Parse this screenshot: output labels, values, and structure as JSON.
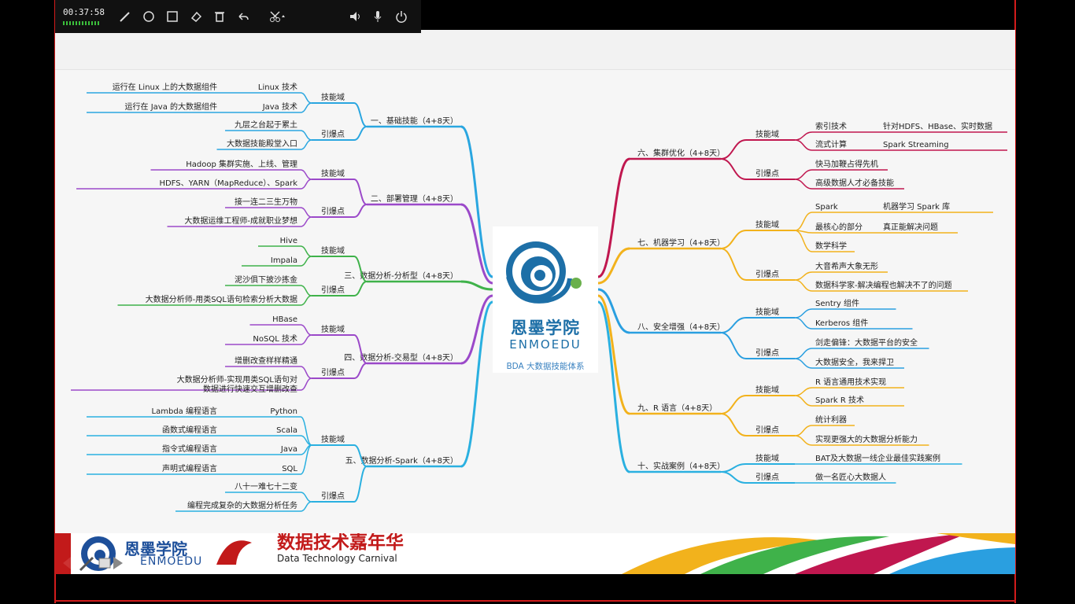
{
  "toolbar": {
    "timer": "00:37:58",
    "tools": [
      "pen-icon",
      "circle-icon",
      "rectangle-icon",
      "eraser-icon",
      "trash-icon",
      "undo-icon",
      "scissors-icon",
      "speaker-icon",
      "microphone-icon",
      "power-icon"
    ]
  },
  "center": {
    "brand_cn": "恩墨学院",
    "brand_en": "ENMOEDU",
    "subtitle": "BDA 大数据技能体系"
  },
  "left_branches": [
    {
      "title": "一、基础技能（4+8天）",
      "color": "#2aa6e0",
      "groups": [
        {
          "label": "技能域",
          "leaves": [
            {
              "text": "Linux 技术",
              "note": "运行在 Linux 上的大数据组件"
            },
            {
              "text": "Java 技术",
              "note": "运行在 Java 的大数据组件"
            }
          ]
        },
        {
          "label": "引爆点",
          "leaves": [
            {
              "text": "九层之台起于累土"
            },
            {
              "text": "大数据技能殿堂入口"
            }
          ]
        }
      ]
    },
    {
      "title": "二、部署管理（4+8天）",
      "color": "#9b49c9",
      "groups": [
        {
          "label": "技能域",
          "leaves": [
            {
              "text": "Hadoop 集群实施、上线、管理"
            },
            {
              "text": "HDFS、YARN（MapReduce）、Spark"
            }
          ]
        },
        {
          "label": "引爆点",
          "leaves": [
            {
              "text": "接一连二三生万物"
            },
            {
              "text": "大数据运维工程师-成就职业梦想"
            }
          ]
        }
      ]
    },
    {
      "title": "三、数据分析-分析型（4+8天）",
      "color": "#3fb24a",
      "groups": [
        {
          "label": "技能域",
          "leaves": [
            {
              "text": "Hive"
            },
            {
              "text": "Impala"
            }
          ]
        },
        {
          "label": "引爆点",
          "leaves": [
            {
              "text": "泥沙俱下披沙拣金"
            },
            {
              "text": "大数据分析师-用类SQL语句检索分析大数据"
            }
          ]
        }
      ]
    },
    {
      "title": "四、数据分析-交易型（4+8天）",
      "color": "#9b49c9",
      "groups": [
        {
          "label": "技能域",
          "leaves": [
            {
              "text": "HBase"
            },
            {
              "text": "NoSQL 技术"
            }
          ]
        },
        {
          "label": "引爆点",
          "leaves": [
            {
              "text": "增删改查样样精通"
            },
            {
              "text": "大数据分析师-实现用类SQL语句对\n数据进行快速交互增删改查"
            }
          ]
        }
      ]
    },
    {
      "title": "五、数据分析-Spark（4+8天）",
      "color": "#2ab0e0",
      "groups": [
        {
          "label": "技能域",
          "leaves": [
            {
              "text": "Python",
              "note": "Lambda 编程语言"
            },
            {
              "text": "Scala",
              "note": "函数式编程语言"
            },
            {
              "text": "Java",
              "note": "指令式编程语言"
            },
            {
              "text": "SQL",
              "note": "声明式编程语言"
            }
          ]
        },
        {
          "label": "引爆点",
          "leaves": [
            {
              "text": "八十一难七十二变"
            },
            {
              "text": "编程完成复杂的大数据分析任务"
            }
          ]
        }
      ]
    }
  ],
  "right_branches": [
    {
      "title": "六、集群优化（4+8天）",
      "color": "#c0174f",
      "groups": [
        {
          "label": "技能域",
          "leaves": [
            {
              "text": "索引技术",
              "note": "针对HDFS、HBase、实时数据"
            },
            {
              "text": "流式计算",
              "note": "Spark Streaming"
            }
          ]
        },
        {
          "label": "引爆点",
          "leaves": [
            {
              "text": "快马加鞭占得先机"
            },
            {
              "text": "高级数据人才必备技能"
            }
          ]
        }
      ]
    },
    {
      "title": "七、机器学习（4+8天）",
      "color": "#f2b21c",
      "groups": [
        {
          "label": "技能域",
          "leaves": [
            {
              "text": "Spark",
              "note": "机器学习 Spark 库"
            },
            {
              "text": "最核心的部分",
              "note": "真正能解决问题"
            },
            {
              "text": "数学科学"
            }
          ]
        },
        {
          "label": "引爆点",
          "leaves": [
            {
              "text": "大音希声大象无形"
            },
            {
              "text": "数据科学家-解决编程也解决不了的问题"
            }
          ]
        }
      ]
    },
    {
      "title": "八、安全增强（4+8天）",
      "color": "#2a9fe0",
      "groups": [
        {
          "label": "技能域",
          "leaves": [
            {
              "text": "Sentry 组件"
            },
            {
              "text": "Kerberos 组件"
            }
          ]
        },
        {
          "label": "引爆点",
          "leaves": [
            {
              "text": "剑走偏锋：大数据平台的安全"
            },
            {
              "text": "大数据安全，我来捍卫"
            }
          ]
        }
      ]
    },
    {
      "title": "九、R 语言（4+8天）",
      "color": "#f2b21c",
      "groups": [
        {
          "label": "技能域",
          "leaves": [
            {
              "text": "R 语言通用技术实现"
            },
            {
              "text": "Spark R 技术"
            }
          ]
        },
        {
          "label": "引爆点",
          "leaves": [
            {
              "text": "统计利器"
            },
            {
              "text": "实现更强大的大数据分析能力"
            }
          ]
        }
      ]
    },
    {
      "title": "十、实战案例（4+8天）",
      "color": "#2ab0e0",
      "groups": [
        {
          "label": "技能域",
          "leaves": [
            {
              "text": "BAT及大数据一线企业最佳实践案例"
            }
          ]
        },
        {
          "label": "引爆点",
          "leaves": [
            {
              "text": "做一名匠心大数据人"
            }
          ]
        }
      ]
    }
  ],
  "banner": {
    "logo_cn": "恩墨学院",
    "logo_en": "ENMOEDU",
    "title": "数据技术嘉年华",
    "subtitle": "Data Technology Carnival"
  }
}
